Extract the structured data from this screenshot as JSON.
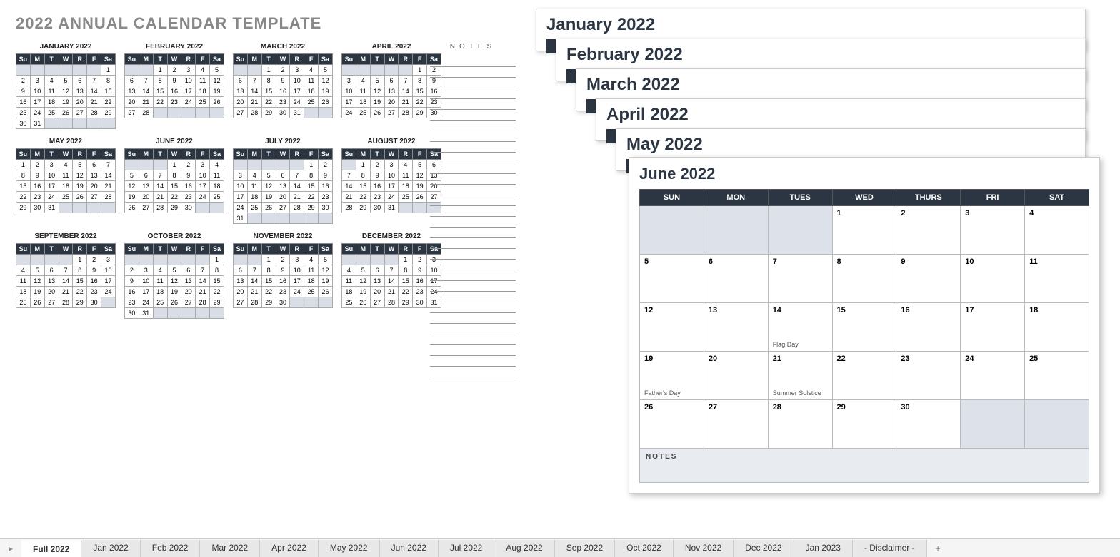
{
  "title": "2022 ANNUAL CALENDAR TEMPLATE",
  "notes_label": "NOTES",
  "dow_short": [
    "Su",
    "M",
    "T",
    "W",
    "R",
    "F",
    "Sa"
  ],
  "dow_long": [
    "SUN",
    "MON",
    "TUES",
    "WED",
    "THURS",
    "FRI",
    "SAT"
  ],
  "mini_months": [
    {
      "name": "JANUARY 2022",
      "start": 6,
      "days": 31
    },
    {
      "name": "FEBRUARY 2022",
      "start": 2,
      "days": 28
    },
    {
      "name": "MARCH 2022",
      "start": 2,
      "days": 31
    },
    {
      "name": "APRIL 2022",
      "start": 5,
      "days": 30
    },
    {
      "name": "MAY 2022",
      "start": 0,
      "days": 31
    },
    {
      "name": "JUNE 2022",
      "start": 3,
      "days": 30
    },
    {
      "name": "JULY 2022",
      "start": 5,
      "days": 31
    },
    {
      "name": "AUGUST 2022",
      "start": 1,
      "days": 31
    },
    {
      "name": "SEPTEMBER 2022",
      "start": 4,
      "days": 30
    },
    {
      "name": "OCTOBER 2022",
      "start": 6,
      "days": 31
    },
    {
      "name": "NOVEMBER 2022",
      "start": 2,
      "days": 30
    },
    {
      "name": "DECEMBER 2022",
      "start": 4,
      "days": 31
    }
  ],
  "stack_titles": [
    "January 2022",
    "February 2022",
    "March 2022",
    "April 2022",
    "May 2022"
  ],
  "big_month": {
    "title": "June 2022",
    "start": 3,
    "days": 30,
    "events": {
      "14": "Flag Day",
      "19": "Father's Day",
      "21": "Summer Solstice"
    },
    "notes_label": "NOTES"
  },
  "tabs": [
    "Full 2022",
    "Jan 2022",
    "Feb 2022",
    "Mar 2022",
    "Apr 2022",
    "May 2022",
    "Jun 2022",
    "Jul 2022",
    "Aug 2022",
    "Sep 2022",
    "Oct 2022",
    "Nov 2022",
    "Dec 2022",
    "Jan 2023",
    "- Disclaimer -"
  ],
  "active_tab": 0
}
